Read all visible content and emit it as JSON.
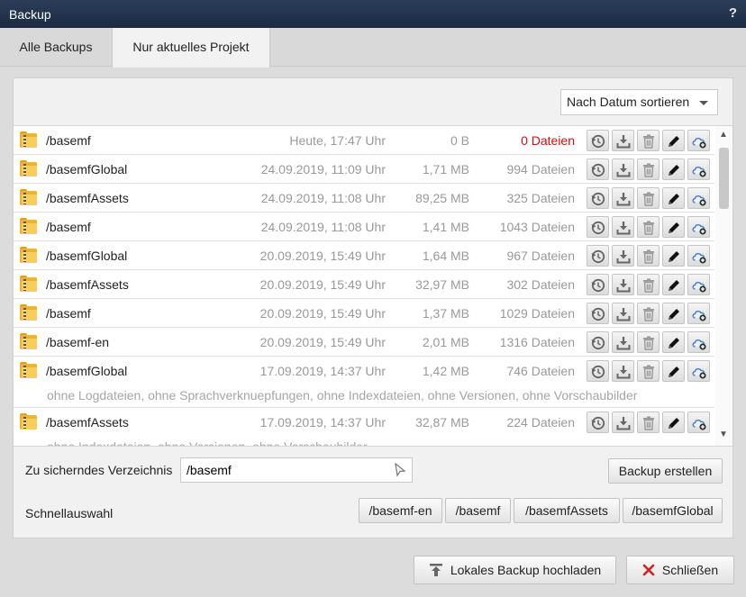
{
  "window": {
    "title": "Backup",
    "help_label": "?"
  },
  "tabs": [
    {
      "label": "Alle Backups",
      "active": false
    },
    {
      "label": "Nur aktuelles Projekt",
      "active": true
    }
  ],
  "sort": {
    "selected": "Nach Datum sortieren"
  },
  "backups": [
    {
      "name": "/basemf",
      "date": "Heute, 17:47 Uhr",
      "size": "0 B",
      "files": "0 Dateien",
      "files_alert": true,
      "note": ""
    },
    {
      "name": "/basemfGlobal",
      "date": "24.09.2019, 11:09 Uhr",
      "size": "1,71 MB",
      "files": "994 Dateien",
      "note": ""
    },
    {
      "name": "/basemfAssets",
      "date": "24.09.2019, 11:08 Uhr",
      "size": "89,25 MB",
      "files": "325 Dateien",
      "note": ""
    },
    {
      "name": "/basemf",
      "date": "24.09.2019, 11:08 Uhr",
      "size": "1,41 MB",
      "files": "1043 Dateien",
      "note": ""
    },
    {
      "name": "/basemfGlobal",
      "date": "20.09.2019, 15:49 Uhr",
      "size": "1,64 MB",
      "files": "967 Dateien",
      "note": ""
    },
    {
      "name": "/basemfAssets",
      "date": "20.09.2019, 15:49 Uhr",
      "size": "32,97 MB",
      "files": "302 Dateien",
      "note": ""
    },
    {
      "name": "/basemf",
      "date": "20.09.2019, 15:49 Uhr",
      "size": "1,37 MB",
      "files": "1029 Dateien",
      "note": ""
    },
    {
      "name": "/basemf-en",
      "date": "20.09.2019, 15:49 Uhr",
      "size": "2,01 MB",
      "files": "1316 Dateien",
      "note": ""
    },
    {
      "name": "/basemfGlobal",
      "date": "17.09.2019, 14:37 Uhr",
      "size": "1,42 MB",
      "files": "746 Dateien",
      "note": "ohne Logdateien, ohne Sprachverknuepfungen, ohne Indexdateien, ohne Versionen, ohne Vorschaubilder"
    },
    {
      "name": "/basemfAssets",
      "date": "17.09.2019, 14:37 Uhr",
      "size": "32,87 MB",
      "files": "224 Dateien",
      "note": "ohne Indexdateien, ohne Versionen, ohne Vorschaubilder"
    }
  ],
  "row_actions": [
    "restore-icon",
    "download-icon",
    "trash-icon",
    "pencil-icon",
    "cloud-upload-icon"
  ],
  "directory": {
    "label": "Zu sicherndes Verzeichnis",
    "value": "/basemf",
    "create_label": "Backup erstellen"
  },
  "quick": {
    "label": "Schnellauswahl",
    "options": [
      "/basemf-en",
      "/basemf",
      "/basemfAssets",
      "/basemfGlobal"
    ]
  },
  "footer": {
    "upload_label": "Lokales Backup hochladen",
    "close_label": "Schließen"
  },
  "colors": {
    "titlebar": "#1f2f48",
    "alert": "#cc1111",
    "close_x": "#d42020"
  }
}
